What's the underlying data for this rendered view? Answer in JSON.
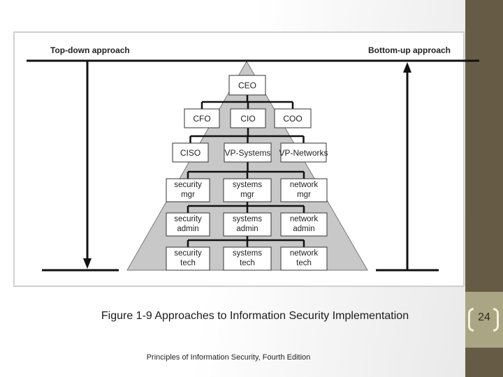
{
  "diagram": {
    "top_down_label": "Top-down approach",
    "bottom_up_label": "Bottom-up approach",
    "levels": [
      {
        "boxes": [
          {
            "lines": [
              "CEO"
            ]
          }
        ]
      },
      {
        "boxes": [
          {
            "lines": [
              "CFO"
            ]
          },
          {
            "lines": [
              "CIO"
            ]
          },
          {
            "lines": [
              "COO"
            ]
          }
        ]
      },
      {
        "boxes": [
          {
            "lines": [
              "CISO"
            ]
          },
          {
            "lines": [
              "VP-Systems"
            ]
          },
          {
            "lines": [
              "VP-Networks"
            ]
          }
        ]
      },
      {
        "boxes": [
          {
            "lines": [
              "security",
              "mgr"
            ]
          },
          {
            "lines": [
              "systems",
              "mgr"
            ]
          },
          {
            "lines": [
              "network",
              "mgr"
            ]
          }
        ]
      },
      {
        "boxes": [
          {
            "lines": [
              "security",
              "admin"
            ]
          },
          {
            "lines": [
              "systems",
              "admin"
            ]
          },
          {
            "lines": [
              "network",
              "admin"
            ]
          }
        ]
      },
      {
        "boxes": [
          {
            "lines": [
              "security",
              "tech"
            ]
          },
          {
            "lines": [
              "systems",
              "tech"
            ]
          },
          {
            "lines": [
              "network",
              "tech"
            ]
          }
        ]
      }
    ]
  },
  "caption": "Figure 1-9 Approaches to Information Security Implementation",
  "footer": "Principles of Information Security, Fourth Edition",
  "page_number": "24",
  "colors": {
    "side_bar": "#665c45",
    "page_box": "#aaa582",
    "pyramid_fill": "#c8c8c8"
  }
}
